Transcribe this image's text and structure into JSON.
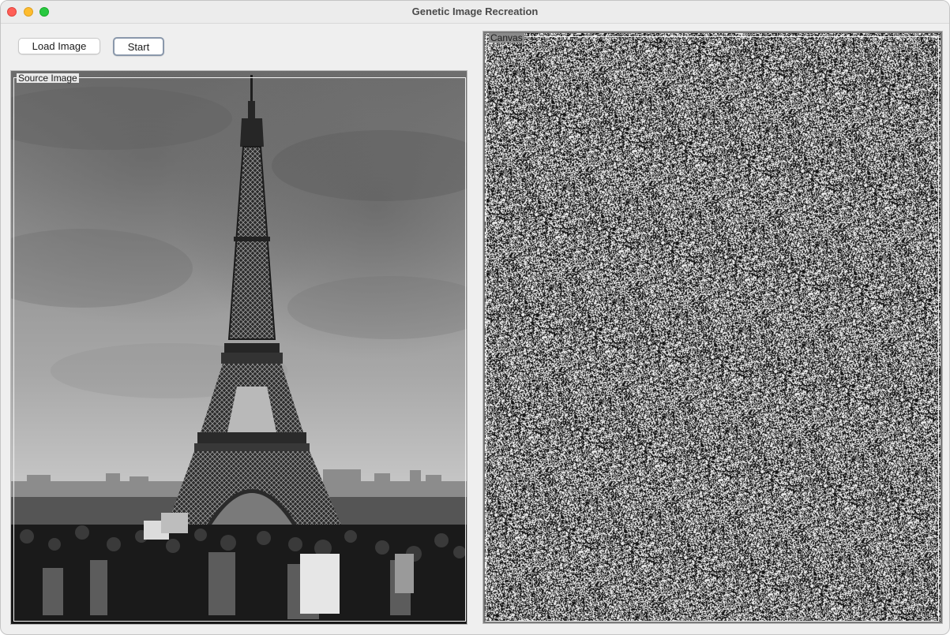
{
  "window": {
    "title": "Genetic Image Recreation"
  },
  "toolbar": {
    "load_label": "Load Image",
    "start_label": "Start"
  },
  "source_panel": {
    "label": "Source Image"
  },
  "canvas_panel": {
    "label": "Canvas"
  },
  "colors": {
    "window_bg": "#efefef",
    "close": "#ff5f57",
    "minimize": "#febc2e",
    "maximize": "#28c840",
    "start_border": "#8a98ab"
  },
  "icons": [
    "close-icon",
    "minimize-icon",
    "maximize-icon"
  ]
}
